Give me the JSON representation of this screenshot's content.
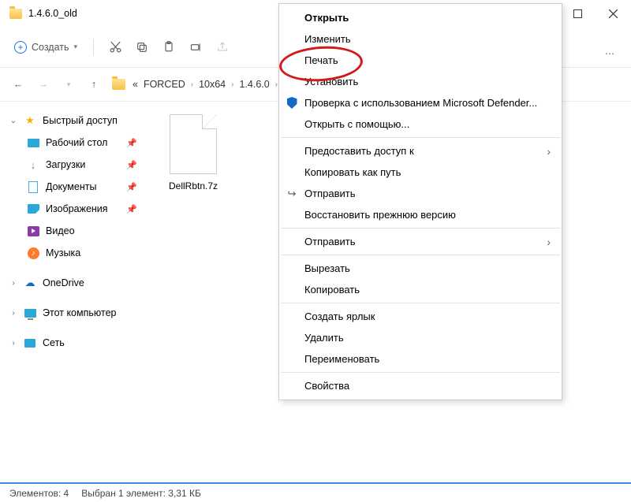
{
  "window": {
    "title": "1.4.6.0_old"
  },
  "toolbar": {
    "create": "Создать"
  },
  "breadcrumb": {
    "root_prefix": "«",
    "parts": [
      "FORCED",
      "10x64",
      "1.4.6.0"
    ]
  },
  "sidebar": {
    "quick": "Быстрый доступ",
    "desktop": "Рабочий стол",
    "downloads": "Загрузки",
    "documents": "Документы",
    "pictures": "Изображения",
    "video": "Видео",
    "music": "Музыка",
    "onedrive": "OneDrive",
    "thispc": "Этот компьютер",
    "network": "Сеть"
  },
  "files": {
    "item1": "DellRbtn.7z"
  },
  "context_menu": {
    "open": "Открыть",
    "edit": "Изменить",
    "print": "Печать",
    "install": "Установить",
    "defender": "Проверка с использованием Microsoft Defender...",
    "open_with": "Открыть с помощью...",
    "give_access": "Предоставить доступ к",
    "copy_path": "Копировать как путь",
    "share": "Отправить",
    "restore": "Восстановить прежнюю версию",
    "send_to": "Отправить",
    "cut": "Вырезать",
    "copy": "Копировать",
    "shortcut": "Создать ярлык",
    "delete": "Удалить",
    "rename": "Переименовать",
    "properties": "Свойства"
  },
  "status": {
    "count": "Элементов: 4",
    "selected": "Выбран 1 элемент: 3,31 КБ"
  }
}
